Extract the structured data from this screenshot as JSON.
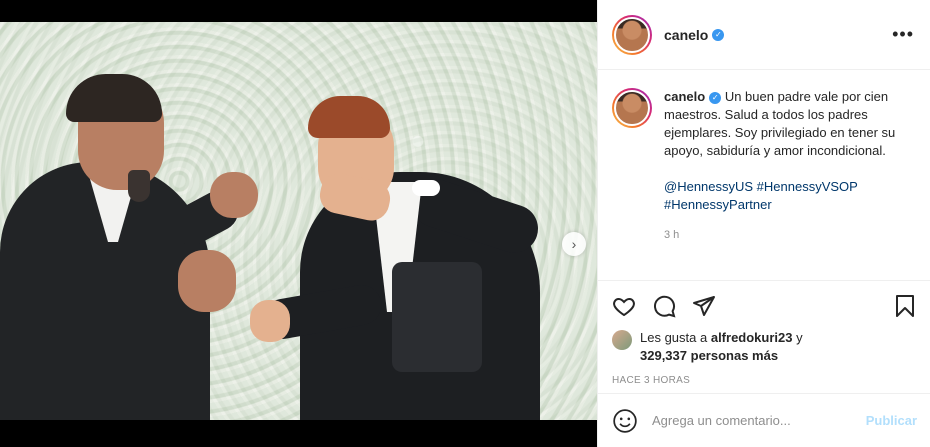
{
  "post": {
    "username": "canelo",
    "verified": true,
    "more_icon": "more-horizontal-icon",
    "caption": {
      "username": "canelo",
      "text": "Un buen padre vale por cien maestros. Salud a todos los padres ejemplares. Soy privilegiado en tener su apoyo, sabiduría y amor incondicional.",
      "tags": "@HennessyUS #HennessyVSOP #HennessyPartner",
      "time": "3 h"
    },
    "actions": {
      "like_icon": "heart-icon",
      "comment_icon": "comment-icon",
      "share_icon": "share-icon",
      "save_icon": "bookmark-icon"
    },
    "likes": {
      "prefix": "Les gusta a",
      "user": "alfredokuri23",
      "connector": "y",
      "count": "329,337",
      "suffix": "personas más"
    },
    "posted_ago": "HACE 3 HORAS",
    "comment": {
      "placeholder": "Agrega un comentario...",
      "publish_label": "Publicar"
    },
    "media": {
      "next_icon": "chevron-right-icon"
    }
  },
  "colors": {
    "verified_blue": "#3897f0",
    "link_blue": "#00376b",
    "publish_disabled": "#b2dffc",
    "muted_text": "#8e8e8e"
  }
}
